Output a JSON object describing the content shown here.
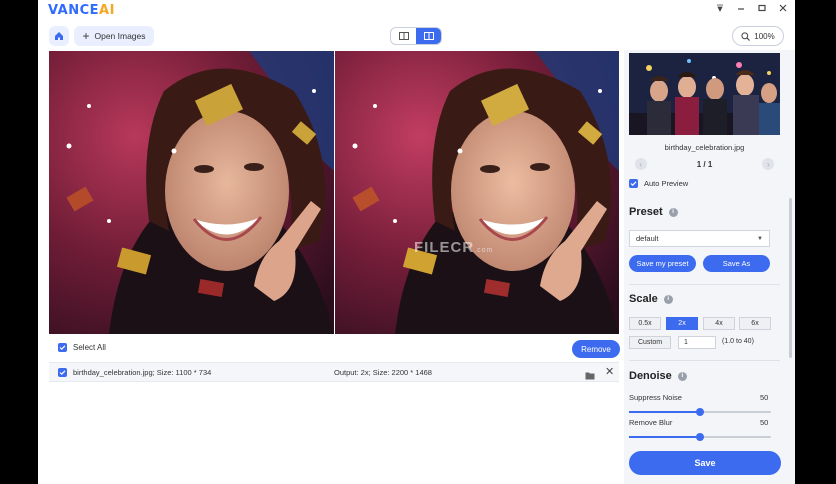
{
  "app": {
    "logo_main": "VANCE",
    "logo_accent": "AI"
  },
  "toolbar": {
    "open_images_label": "Open Images",
    "zoom_label": "100%"
  },
  "preview": {
    "watermark": "FILECR",
    "watermark_sub": ".com"
  },
  "list": {
    "select_all_label": "Select All",
    "remove_label": "Remove",
    "rows": [
      {
        "file": "birthday_celebration.jpg; Size: 1100 * 734",
        "output": "Output: 2x; Size: 2200 * 1468"
      }
    ]
  },
  "sidebar": {
    "thumbnail_name": "birthday_celebration.jpg",
    "page_indicator": "1 / 1",
    "auto_preview_label": "Auto Preview",
    "preset": {
      "title": "Preset",
      "selected": "default",
      "save_my_preset_label": "Save my preset",
      "save_as_label": "Save As"
    },
    "scale": {
      "title": "Scale",
      "options": [
        "0.5x",
        "2x",
        "4x",
        "6x"
      ],
      "selected": "2x",
      "custom_label": "Custom",
      "custom_value": "1",
      "custom_range": "(1.0 to 40)"
    },
    "denoise": {
      "title": "Denoise",
      "suppress_noise_label": "Suppress Noise",
      "suppress_noise_value": "50",
      "remove_blur_label": "Remove Blur",
      "remove_blur_value": "50",
      "suppress_noise_level": 0.5,
      "remove_blur_level": 0.5
    },
    "save_label": "Save"
  },
  "colors": {
    "accent": "#3c6bf0",
    "logo_blue": "#2f6bff",
    "logo_orange": "#f5a623"
  }
}
